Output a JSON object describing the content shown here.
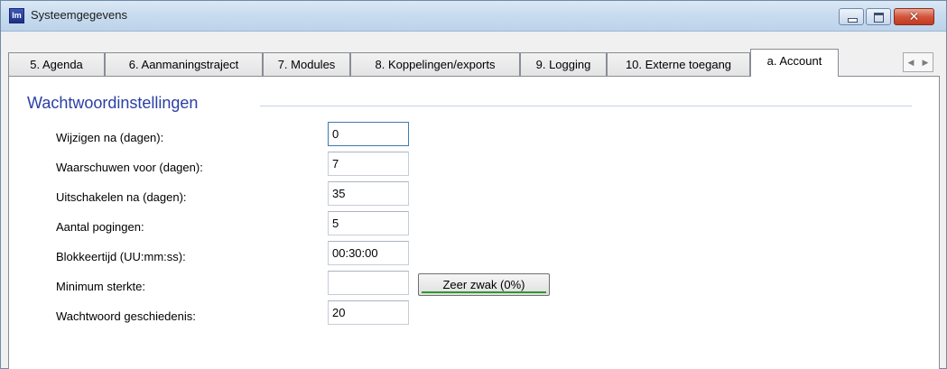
{
  "window": {
    "title": "Systeemgegevens",
    "icon_text": "Im"
  },
  "tabs": [
    {
      "label": "5. Agenda"
    },
    {
      "label": "6. Aanmaningstraject"
    },
    {
      "label": "7. Modules"
    },
    {
      "label": "8. Koppelingen/exports"
    },
    {
      "label": "9. Logging"
    },
    {
      "label": "10. Externe toegang"
    },
    {
      "label": "a. Account",
      "active": true
    }
  ],
  "tab_scroll": {
    "left": "◀",
    "right": "▶"
  },
  "section": {
    "title": "Wachtwoordinstellingen",
    "fields": [
      {
        "label": "Wijzigen na (dagen):",
        "value": "0"
      },
      {
        "label": "Waarschuwen voor (dagen):",
        "value": "7"
      },
      {
        "label": "Uitschakelen na (dagen):",
        "value": "35"
      },
      {
        "label": "Aantal pogingen:",
        "value": "5"
      },
      {
        "label": "Blokkeertijd (UU:mm:ss):",
        "value": "00:30:00"
      },
      {
        "label": "Minimum sterkte:",
        "value": ""
      },
      {
        "label": "Wachtwoord geschiedenis:",
        "value": "20"
      }
    ],
    "strength_button": {
      "label": "Zeer zwak (0%)",
      "level": 0
    }
  },
  "colors": {
    "section_title": "#2a3fa5",
    "strength_indicator": "#2a9a2a",
    "close_button": "#c23a21"
  }
}
